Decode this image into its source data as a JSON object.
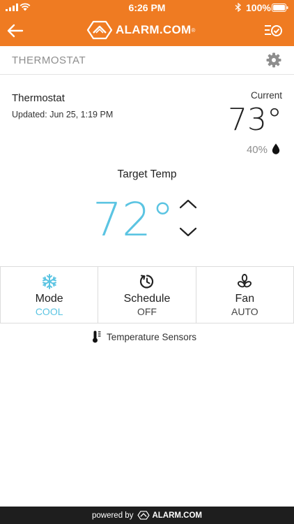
{
  "status_bar": {
    "time": "6:26 PM",
    "battery": "100%"
  },
  "header": {
    "brand": "ALARM.COM",
    "reg": "®"
  },
  "section": {
    "title": "THERMOSTAT"
  },
  "device": {
    "name": "Thermostat",
    "updated": "Updated: Jun 25, 1:19 PM",
    "current_label": "Current",
    "current_temp": "73°",
    "humidity": "40%"
  },
  "target": {
    "label": "Target Temp",
    "temp": "72°"
  },
  "controls": [
    {
      "label": "Mode",
      "value": "COOL",
      "icon": "snowflake-icon"
    },
    {
      "label": "Schedule",
      "value": "OFF",
      "icon": "schedule-clock-icon"
    },
    {
      "label": "Fan",
      "value": "AUTO",
      "icon": "fan-icon"
    }
  ],
  "sensors_link": {
    "label": "Temperature Sensors"
  },
  "footer": {
    "powered_by": "powered by",
    "brand": "ALARM.COM"
  },
  "colors": {
    "header_orange": "#ef7b22",
    "accent_blue": "#5bc4e2",
    "footer_dark": "#1e1e1e"
  }
}
